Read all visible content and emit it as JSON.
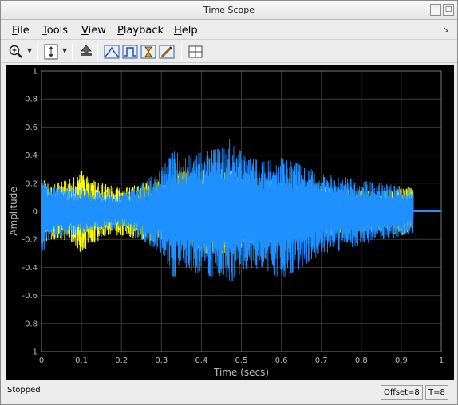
{
  "window": {
    "title": "Time Scope"
  },
  "menu": {
    "items": [
      {
        "mnemonic": "F",
        "rest": "ile"
      },
      {
        "mnemonic": "T",
        "rest": "ools"
      },
      {
        "mnemonic": "V",
        "rest": "iew"
      },
      {
        "mnemonic": "P",
        "rest": "layback"
      },
      {
        "mnemonic": "H",
        "rest": "elp"
      }
    ]
  },
  "icons": [
    "zoom-in-icon",
    "scale-axes-icon",
    "restore-view-icon",
    "peak-finder-icon",
    "bilevel-measurements-icon",
    "cursor-measurements-icon",
    "signal-statistics-icon",
    "layout-icon"
  ],
  "chart_data": {
    "type": "line",
    "xlabel": "Time (secs)",
    "ylabel": "Amplitude",
    "xlim": [
      0,
      1
    ],
    "ylim": [
      -1,
      1
    ],
    "xticks": [
      "0",
      "0.1",
      "0.2",
      "0.3",
      "0.4",
      "0.5",
      "0.6",
      "0.7",
      "0.8",
      "0.9",
      "1"
    ],
    "yticks": [
      "1",
      "0.8",
      "0.6",
      "0.4",
      "0.2",
      "0",
      "-0.2",
      "-0.4",
      "-0.6",
      "-0.8",
      "-1"
    ],
    "grid": true,
    "background": "#000000",
    "series": [
      {
        "color": "#ffff00",
        "envelope": {
          "t": [
            0,
            0.02,
            0.05,
            0.08,
            0.1,
            0.12,
            0.15,
            0.18,
            0.2,
            0.25,
            0.3,
            0.35,
            0.4,
            0.45,
            0.5,
            0.55,
            0.6,
            0.65,
            0.7,
            0.75,
            0.8,
            0.85,
            0.9,
            0.93
          ],
          "upper": [
            0.23,
            0.2,
            0.21,
            0.24,
            0.29,
            0.23,
            0.2,
            0.18,
            0.16,
            0.2,
            0.22,
            0.28,
            0.3,
            0.3,
            0.27,
            0.24,
            0.22,
            0.18,
            0.2,
            0.16,
            0.15,
            0.14,
            0.18,
            0.16
          ],
          "lower": [
            -0.25,
            -0.2,
            -0.2,
            -0.22,
            -0.3,
            -0.24,
            -0.2,
            -0.18,
            -0.17,
            -0.2,
            -0.22,
            -0.27,
            -0.3,
            -0.3,
            -0.27,
            -0.24,
            -0.22,
            -0.2,
            -0.2,
            -0.16,
            -0.15,
            -0.14,
            -0.17,
            -0.15
          ]
        }
      },
      {
        "color": "#1e90ff",
        "envelope": {
          "t": [
            0,
            0.02,
            0.05,
            0.08,
            0.1,
            0.12,
            0.15,
            0.18,
            0.2,
            0.25,
            0.3,
            0.33,
            0.35,
            0.4,
            0.45,
            0.48,
            0.5,
            0.55,
            0.6,
            0.65,
            0.7,
            0.75,
            0.8,
            0.85,
            0.9,
            0.93
          ],
          "upper": [
            0.22,
            0.18,
            0.17,
            0.16,
            0.18,
            0.15,
            0.14,
            0.13,
            0.12,
            0.2,
            0.3,
            0.45,
            0.38,
            0.42,
            0.45,
            0.55,
            0.42,
            0.35,
            0.38,
            0.33,
            0.27,
            0.25,
            0.22,
            0.2,
            0.18,
            0.15
          ],
          "lower": [
            -0.3,
            -0.22,
            -0.18,
            -0.17,
            -0.18,
            -0.16,
            -0.14,
            -0.13,
            -0.12,
            -0.2,
            -0.3,
            -0.48,
            -0.4,
            -0.45,
            -0.48,
            -0.5,
            -0.44,
            -0.4,
            -0.48,
            -0.4,
            -0.3,
            -0.28,
            -0.24,
            -0.2,
            -0.18,
            -0.15
          ]
        }
      }
    ],
    "signal_end": 0.93
  },
  "status": {
    "state": "Stopped",
    "offset": "Offset=8",
    "time": "T=8"
  }
}
